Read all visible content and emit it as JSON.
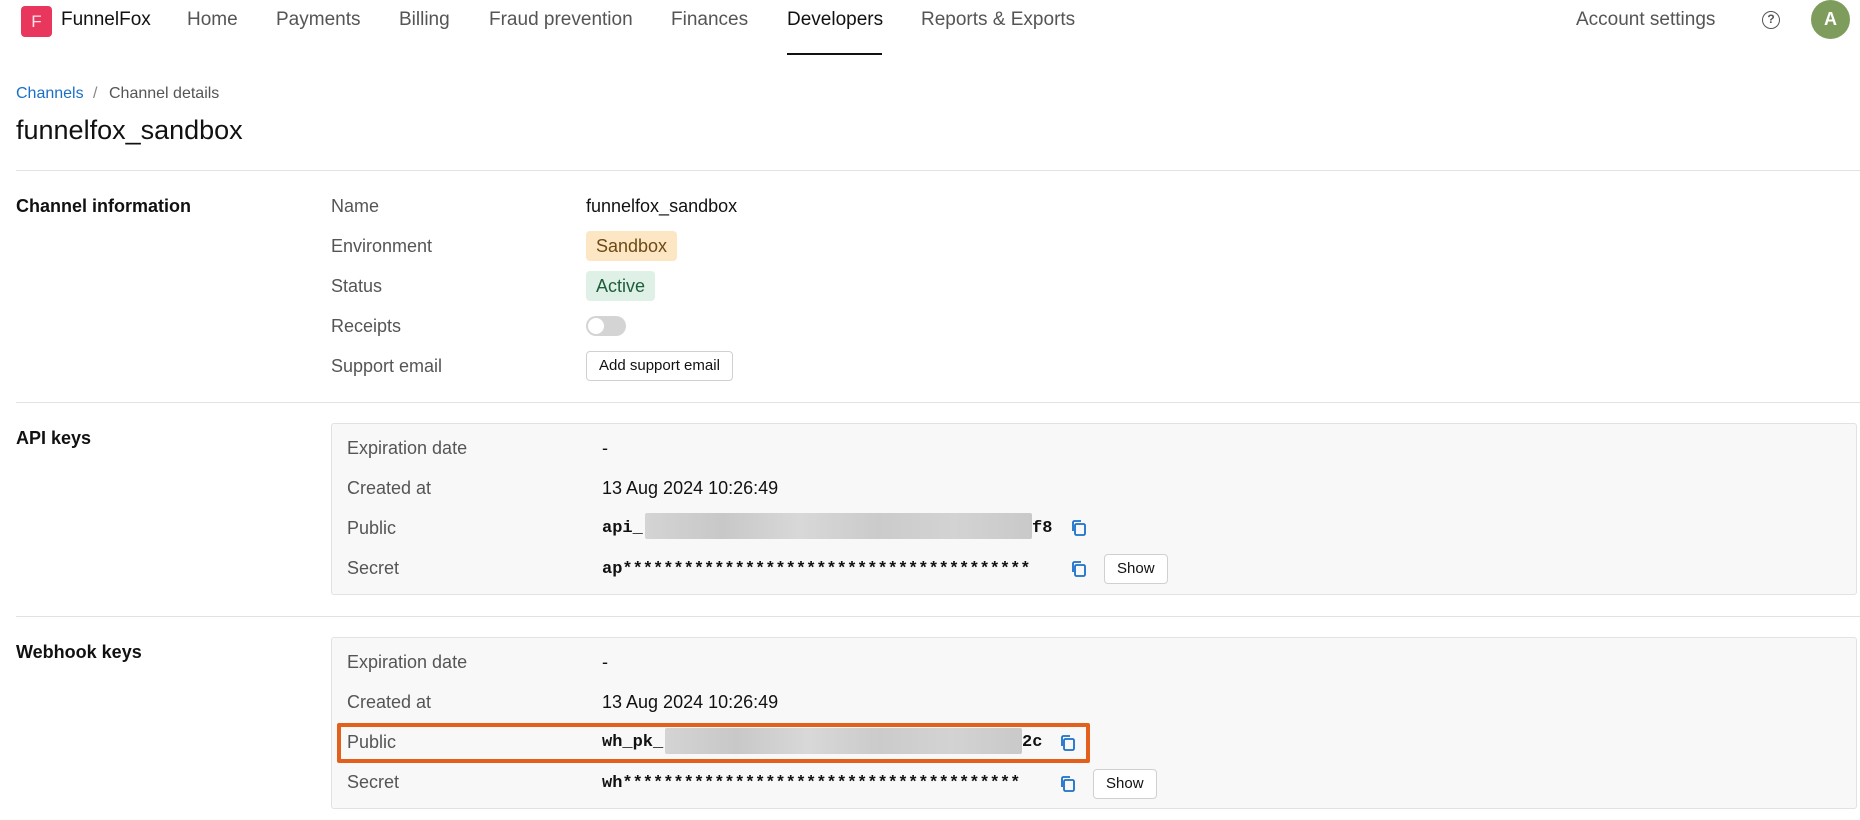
{
  "app": {
    "logo_letter": "F",
    "brand": "FunnelFox",
    "accent_color": "#e8365d"
  },
  "nav": {
    "items": [
      "Home",
      "Payments",
      "Billing",
      "Fraud prevention",
      "Finances",
      "Developers",
      "Reports & Exports"
    ],
    "active": "Developers",
    "account_settings": "Account settings",
    "help_icon": "question-circle-icon",
    "avatar_letter": "A"
  },
  "breadcrumb": {
    "parent": "Channels",
    "separator": "/",
    "current": "Channel details"
  },
  "page": {
    "title": "funnelfox_sandbox"
  },
  "channel_info": {
    "section_title": "Channel information",
    "name_label": "Name",
    "name_value": "funnelfox_sandbox",
    "environment_label": "Environment",
    "environment_value": "Sandbox",
    "status_label": "Status",
    "status_value": "Active",
    "receipts_label": "Receipts",
    "receipts_enabled": false,
    "support_email_label": "Support email",
    "add_support_email_button": "Add support email"
  },
  "api_keys": {
    "section_title": "API keys",
    "expiration_label": "Expiration date",
    "expiration_value": "-",
    "created_label": "Created at",
    "created_value": "13 Aug 2024 10:26:49",
    "public_label": "Public",
    "public_prefix": "api_",
    "public_suffix": "f8",
    "secret_label": "Secret",
    "secret_value": "ap****************************************",
    "show_button": "Show"
  },
  "webhook_keys": {
    "section_title": "Webhook keys",
    "expiration_label": "Expiration date",
    "expiration_value": "-",
    "created_label": "Created at",
    "created_value": "13 Aug 2024 10:26:49",
    "public_label": "Public",
    "public_prefix": "wh_pk_",
    "public_suffix": "2c",
    "secret_label": "Secret",
    "secret_value": "wh***************************************",
    "show_button": "Show"
  },
  "icons": {
    "copy": "copy-icon"
  },
  "colors": {
    "link": "#1a6fc9",
    "sandbox_badge": "#fde6c4",
    "active_badge": "#dff1e6",
    "highlight": "#e3601c",
    "copy_icon": "#1a6fc9"
  }
}
